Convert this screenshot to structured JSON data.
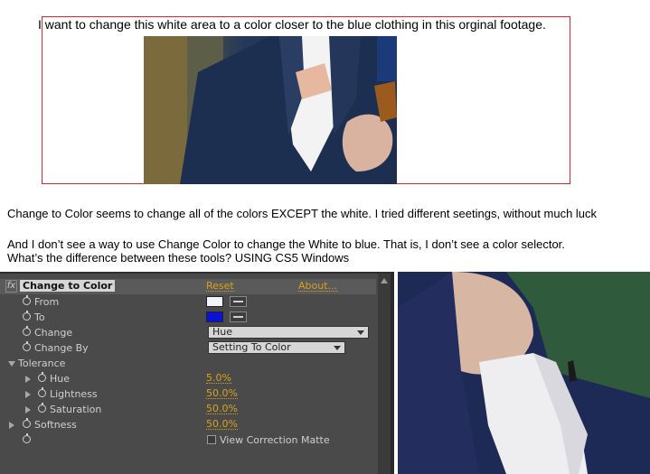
{
  "top_caption": "I want to change this white area to a color closer to the blue clothing in this orginal footage.",
  "paragraphs": [
    "Change to Color seems to change all of the colors EXCEPT the white.   I tried different seetings, without much luck",
    "And I don’t see a way to use Change Color to change the White to blue.  That is, I don’t see a color selector.",
    "What’s the difference between these tools?   USING CS5 Windows"
  ],
  "effect_panel": {
    "fx_glyph": "fx",
    "effect_name": "Change to Color",
    "reset_label": "Reset",
    "about_label": "About...",
    "rows": {
      "from": {
        "label": "From",
        "color": "#f2f4ff"
      },
      "to": {
        "label": "To",
        "color": "#0a12d6"
      },
      "change": {
        "label": "Change",
        "value": "Hue"
      },
      "change_by": {
        "label": "Change By",
        "value": "Setting To Color"
      },
      "tolerance": {
        "label": "Tolerance"
      },
      "hue": {
        "label": "Hue",
        "value": "5.0%"
      },
      "lightness": {
        "label": "Lightness",
        "value": "50.0%"
      },
      "saturation": {
        "label": "Saturation",
        "value": "50.0%"
      },
      "softness": {
        "label": "Softness",
        "value": "50.0%"
      },
      "view_matte": {
        "label": "View Correction Matte"
      }
    }
  },
  "colors": {
    "panel_bg": "#4a4a4a",
    "value_orange": "#d9a21b",
    "border_red": "#d9262a"
  }
}
